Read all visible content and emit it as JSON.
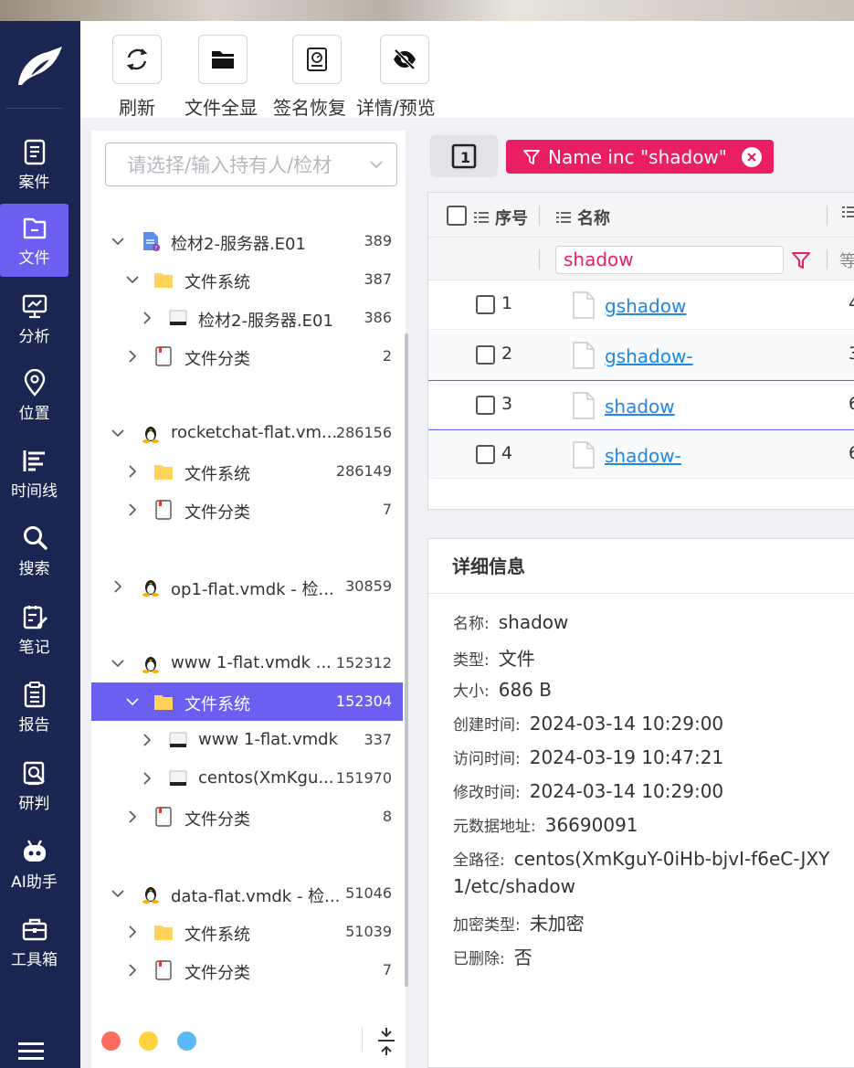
{
  "toolbar": {
    "buttons": [
      {
        "label": "刷新",
        "icon": "refresh-icon"
      },
      {
        "label": "文件全显",
        "icon": "folder-icon"
      },
      {
        "label": "签名恢复",
        "icon": "disk-recover-icon"
      },
      {
        "label": "详情/预览",
        "icon": "eye-off-icon"
      }
    ]
  },
  "nav": {
    "items": [
      {
        "label": "案件",
        "icon": "case-icon"
      },
      {
        "label": "文件",
        "icon": "file-icon",
        "active": true
      },
      {
        "label": "分析",
        "icon": "analysis-icon"
      },
      {
        "label": "位置",
        "icon": "location-icon"
      },
      {
        "label": "时间线",
        "icon": "timeline-icon"
      },
      {
        "label": "搜索",
        "icon": "search-icon"
      },
      {
        "label": "笔记",
        "icon": "note-icon"
      },
      {
        "label": "报告",
        "icon": "report-icon"
      },
      {
        "label": "研判",
        "icon": "judge-icon"
      },
      {
        "label": "AI助手",
        "icon": "robot-icon"
      },
      {
        "label": "工具箱",
        "icon": "toolbox-icon"
      }
    ]
  },
  "tree": {
    "placeholder": "请选择/输入持有人/检材",
    "nodes": [
      {
        "name": "检材2-服务器.E01",
        "count": "389"
      },
      {
        "name": "文件系统",
        "count": "387"
      },
      {
        "name": "检材2-服务器.E01",
        "count": "386"
      },
      {
        "name": "文件分类",
        "count": "2"
      },
      {
        "name": "rocketchat-flat.vm...",
        "count": "286156"
      },
      {
        "name": "文件系统",
        "count": "286149"
      },
      {
        "name": "文件分类",
        "count": "7"
      },
      {
        "name": "op1-flat.vmdk - 检...",
        "count": "30859"
      },
      {
        "name": "www 1-flat.vmdk ...",
        "count": "152312"
      },
      {
        "name": "文件系统",
        "count": "152304"
      },
      {
        "name": "www 1-flat.vmdk",
        "count": "337"
      },
      {
        "name": "centos(XmKgu...",
        "count": "151970"
      },
      {
        "name": "文件分类",
        "count": "8"
      },
      {
        "name": "data-flat.vmdk - 检...",
        "count": "51046"
      },
      {
        "name": "文件系统",
        "count": "51039"
      },
      {
        "name": "文件分类",
        "count": "7"
      }
    ]
  },
  "status_dots": {
    "colors": [
      "#ff6b5f",
      "#ffd23f",
      "#5ab8f5"
    ]
  },
  "filter": {
    "page_button": "1",
    "chip_label": "Name inc \"shadow\""
  },
  "grid": {
    "headers": {
      "index": "序号",
      "name": "名称"
    },
    "name_filter": "shadow",
    "rows": [
      {
        "no": "1",
        "name": "gshadow",
        "tail": "4"
      },
      {
        "no": "2",
        "name": "gshadow-",
        "tail": "3"
      },
      {
        "no": "3",
        "name": "shadow",
        "tail": "6"
      },
      {
        "no": "4",
        "name": "shadow-",
        "tail": "6"
      }
    ],
    "filter_tail": "等"
  },
  "detail": {
    "title": "详细信息",
    "fields": [
      {
        "k": "名称:",
        "v": "shadow"
      },
      {
        "k": "类型:",
        "v": "文件"
      },
      {
        "k": "大小:",
        "v": "686 B"
      },
      {
        "k": "创建时间:",
        "v": "2024-03-14 10:29:00"
      },
      {
        "k": "访问时间:",
        "v": "2024-03-19 10:47:21"
      },
      {
        "k": "修改时间:",
        "v": "2024-03-14 10:29:00"
      },
      {
        "k": "元数据地址:",
        "v": "36690091"
      },
      {
        "k": "全路径:",
        "v": "centos(XmKguY-0iHb-bjvI-f6eC-JXY"
      },
      {
        "k": "",
        "v": "1/etc/shadow"
      },
      {
        "k": "加密类型:",
        "v": "未加密"
      },
      {
        "k": "已删除:",
        "v": "否"
      }
    ]
  }
}
